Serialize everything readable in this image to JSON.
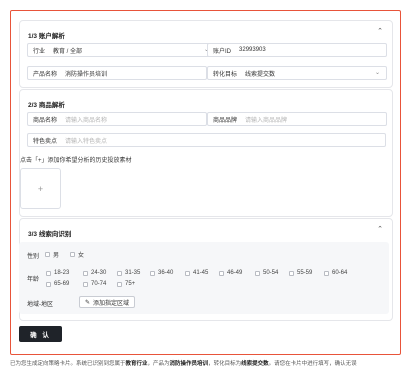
{
  "section1": {
    "title": "1/3 账户解析",
    "collapse_icon": "chevron-up-icon",
    "industry_label": "行业",
    "industry_value": "教育 / 全部",
    "account_label": "账户ID",
    "account_value": "32993903",
    "product_label": "产品名称",
    "product_value": "消防操作员培训",
    "goal_label": "转化目标",
    "goal_value": "线索提交数"
  },
  "section2": {
    "title": "2/3 商品解析",
    "collapse_icon": "chevron-up-icon",
    "item_name_label": "商品名称",
    "item_name_placeholder": "请输入商品名称",
    "brand_label": "商品品牌",
    "brand_placeholder": "请输入商品品牌",
    "selling_label": "特色卖点",
    "selling_placeholder": "请输入特色卖点",
    "upload_hint": "点击「+」添加你希望分析的历史投放素材",
    "upload_plus": "+"
  },
  "section3": {
    "title": "3/3 线索向识别",
    "collapse_icon": "chevron-up-icon",
    "gender_label": "性别",
    "gender_options": [
      "男",
      "女"
    ],
    "age_label": "年龄",
    "age_options": [
      "18-23",
      "24-30",
      "31-35",
      "36-40",
      "41-45",
      "46-49",
      "50-54",
      "55-59",
      "60-64",
      "65-69",
      "70-74",
      "75+"
    ],
    "region_label": "地域-地区",
    "region_button": "添加指定区域",
    "region_icon": "edit-icon"
  },
  "confirm_button": "确 认",
  "footer": {
    "prefix": "已为您生成定向策略卡片。系统已识别到您属于",
    "industry": "教育行业",
    "mid1": "，产品为",
    "product": "消防操作员培训",
    "mid2": "，转化目标为",
    "goal": "线索提交数",
    "suffix": "。请您在卡片中进行填写，确认无误"
  }
}
